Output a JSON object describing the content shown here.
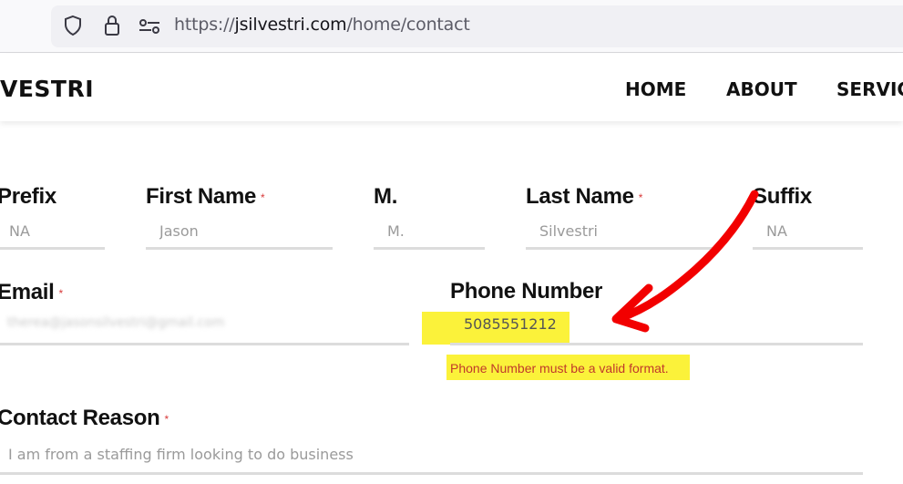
{
  "browser": {
    "url_scheme": "https://",
    "url_host": "jsilvestri.com",
    "url_path": "/home/contact",
    "icons": [
      "shield-icon",
      "lock-icon",
      "tracking-settings-icon"
    ]
  },
  "site": {
    "logo_text": "VESTRI",
    "nav": [
      "HOME",
      "ABOUT",
      "SERVIC"
    ]
  },
  "form": {
    "prefix": {
      "label": "Prefix",
      "placeholder": "NA"
    },
    "first_name": {
      "label": "First Name",
      "required": "*",
      "placeholder": "Jason"
    },
    "middle": {
      "label": "M.",
      "placeholder": "M."
    },
    "last_name": {
      "label": "Last Name",
      "required": "*",
      "placeholder": "Silvestri"
    },
    "suffix": {
      "label": "Suffix",
      "placeholder": "NA"
    },
    "email": {
      "label": "Email",
      "required": "*",
      "value": "therea@jasonsilvestri@gmail.com"
    },
    "phone": {
      "label": "Phone Number",
      "value": "5085551212",
      "error": "Phone Number must be a valid format."
    },
    "contact_reason": {
      "label": "Contact Reason",
      "required": "*",
      "placeholder": "I am from a staffing firm looking to do business"
    }
  },
  "annotation": {
    "highlight_color": "#fbf23a",
    "arrow_color": "#f20000"
  }
}
